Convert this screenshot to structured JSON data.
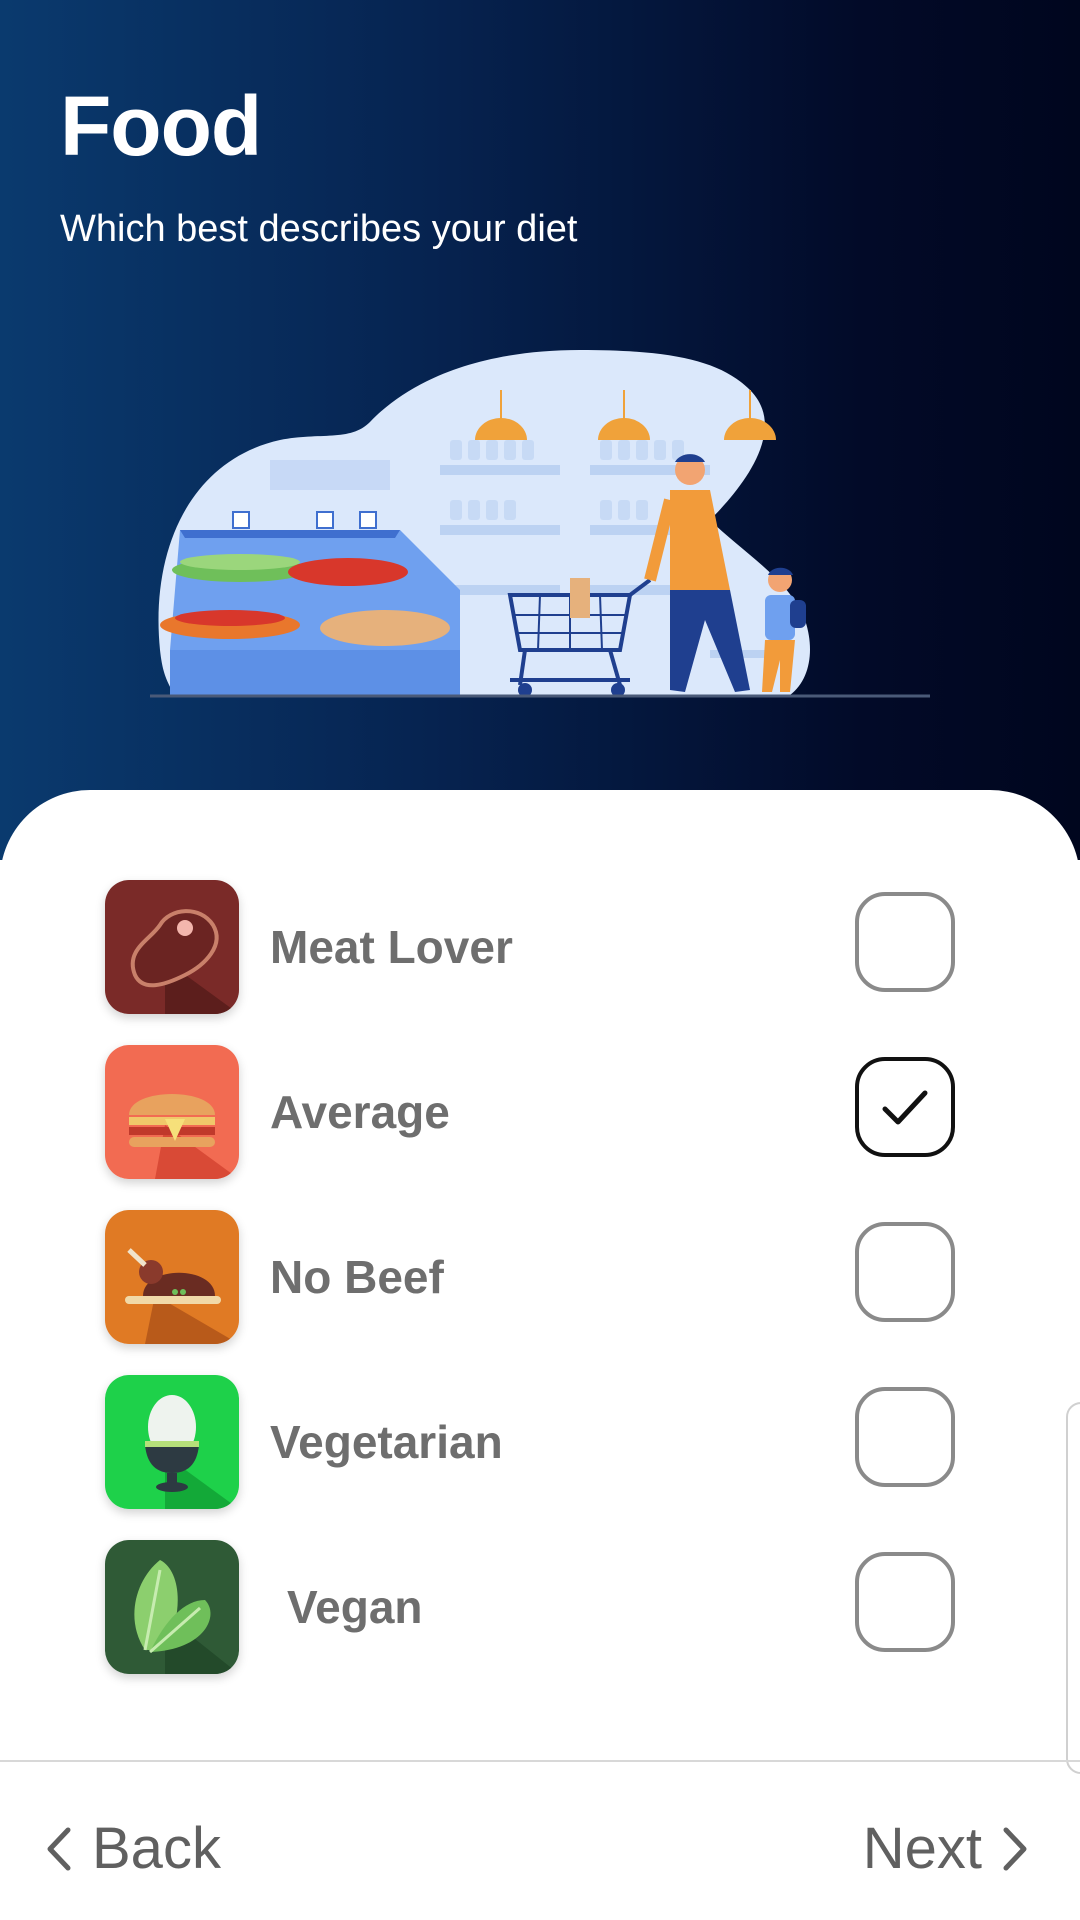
{
  "header": {
    "title": "Food",
    "subtitle": "Which best describes your diet"
  },
  "options": [
    {
      "label": "Meat Lover",
      "icon": "steak-icon",
      "color": "#7a2a28",
      "checked": false
    },
    {
      "label": "Average",
      "icon": "burger-icon",
      "color": "#f26b52",
      "checked": true
    },
    {
      "label": "No Beef",
      "icon": "roast-chicken-icon",
      "color": "#e07a24",
      "checked": false
    },
    {
      "label": "Vegetarian",
      "icon": "egg-cup-icon",
      "color": "#1ed14a",
      "checked": false
    },
    {
      "label": "Vegan",
      "icon": "lettuce-leaf-icon",
      "color": "#2f5a36",
      "checked": false
    }
  ],
  "footer": {
    "back_label": "Back",
    "next_label": "Next"
  }
}
